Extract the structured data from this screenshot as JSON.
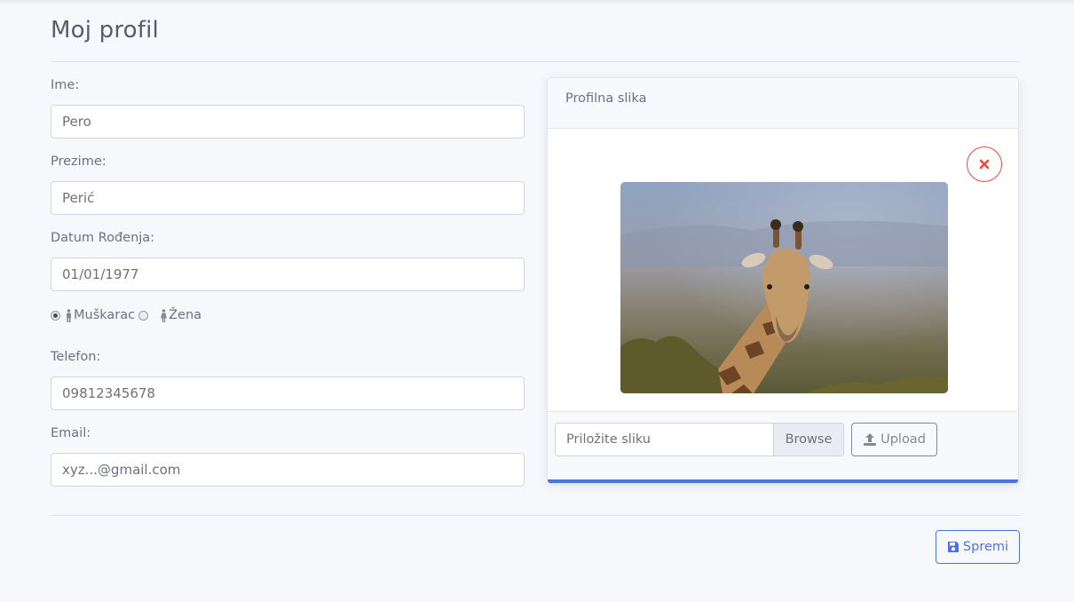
{
  "page": {
    "title": "Moj profil"
  },
  "form": {
    "first_name": {
      "label": "Ime:",
      "value": "Pero"
    },
    "last_name": {
      "label": "Prezime:",
      "value": "Perić"
    },
    "birth_date": {
      "label": "Datum Rođenja:",
      "value": "01/01/1977"
    },
    "gender": {
      "options": [
        {
          "label": "Muškarac",
          "selected": true,
          "icon": "male-icon"
        },
        {
          "label": "Žena",
          "selected": false,
          "icon": "female-icon"
        }
      ]
    },
    "phone": {
      "label": "Telefon:",
      "value": "09812345678"
    },
    "email": {
      "label": "Email:",
      "value": "xyz...@gmail.com"
    }
  },
  "profile_picture": {
    "header": "Profilna slika",
    "remove_icon": "close-icon",
    "file_placeholder": "Priložite sliku",
    "browse_label": "Browse",
    "upload_label": "Upload",
    "upload_icon": "upload-icon"
  },
  "actions": {
    "save_label": "Spremi",
    "save_icon": "floppy-disk-icon"
  },
  "colors": {
    "accent": "#4e73df",
    "danger": "#e74a3b",
    "background": "#f7f8fc",
    "text": "#6e707e"
  }
}
